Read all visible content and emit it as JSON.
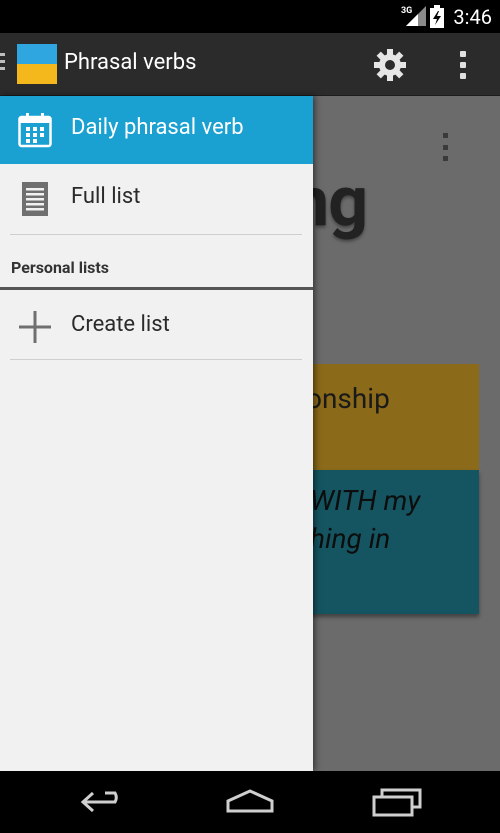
{
  "status_bar": {
    "network_label": "3G",
    "time": "3:46"
  },
  "action_bar": {
    "title": "Phrasal verbs",
    "icons": [
      "drawer-indicator-icon",
      "app-icon",
      "gear-icon",
      "overflow-menu-icon"
    ]
  },
  "content": {
    "word_fragment": "ng",
    "meaning_fragment": "onship",
    "example_line1": "WITH my",
    "example_line2": "hing in"
  },
  "drawer": {
    "items": [
      {
        "label": "Daily phrasal verb",
        "icon": "calendar-icon",
        "active": true
      },
      {
        "label": "Full list",
        "icon": "list-document-icon",
        "active": false
      }
    ],
    "section_header": "Personal lists",
    "create_item": {
      "label": "Create list",
      "icon": "plus-icon"
    }
  },
  "nav_bar": {
    "buttons": [
      "back-icon",
      "home-icon",
      "recent-apps-icon"
    ]
  },
  "colors": {
    "accent": "#1aa1d1",
    "action_bar": "#2b2b2b",
    "drawer_bg": "#f1f1f1",
    "meaning_card": "#8b6a1a",
    "example_card": "#145561"
  }
}
